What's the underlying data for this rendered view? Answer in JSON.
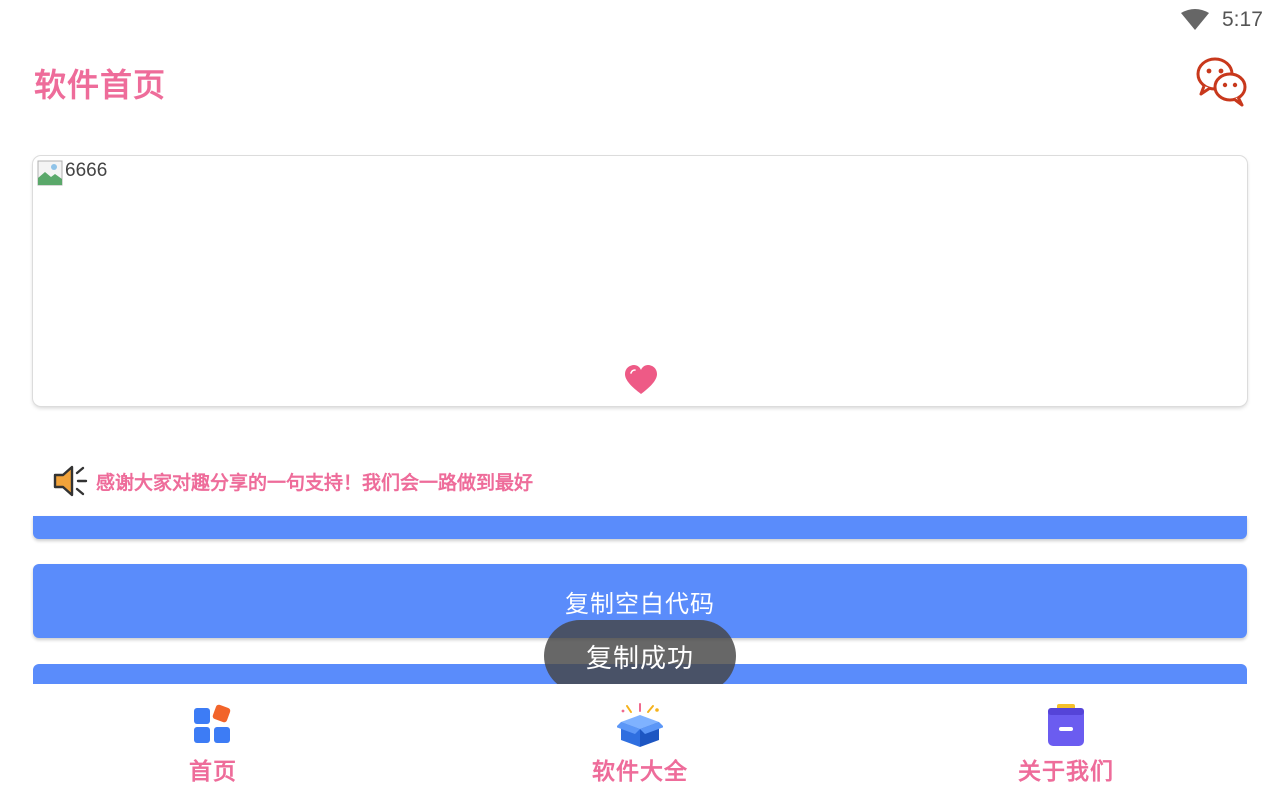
{
  "status_bar": {
    "time": "5:17"
  },
  "header": {
    "title": "软件首页",
    "icon": "wechat-icon"
  },
  "banner": {
    "image_alt": "6666",
    "indicator_icon": "heart-icon"
  },
  "notice": {
    "icon": "speaker-icon",
    "text": "感谢大家对趣分享的一句支持！我们会一路做到最好"
  },
  "buttons": {
    "main_label": "复制空白代码"
  },
  "toast": {
    "text": "复制成功"
  },
  "bottom_nav": [
    {
      "label": "首页",
      "icon": "grid-apps-icon"
    },
    {
      "label": "软件大全",
      "icon": "gift-box-icon"
    },
    {
      "label": "关于我们",
      "icon": "folder-icon"
    }
  ],
  "colors": {
    "accent_pink": "#ee6c9a",
    "button_blue": "#5a8cfb",
    "wechat_red": "#c8381c"
  }
}
